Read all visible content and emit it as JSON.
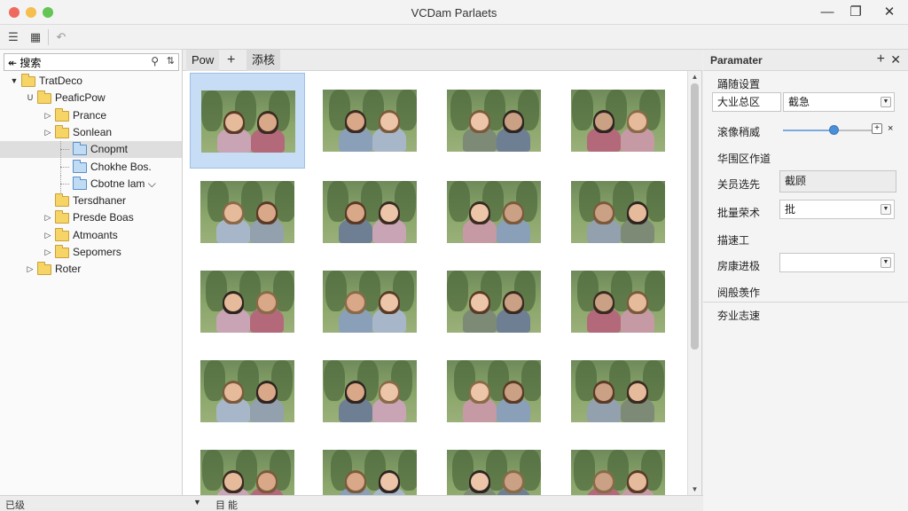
{
  "window": {
    "title": "VCDam Parlaets"
  },
  "toolbar": {
    "icons": [
      "list-icon",
      "grid-icon",
      "back-icon"
    ]
  },
  "search": {
    "value": "搜索",
    "prefix": "↞"
  },
  "tree": {
    "items": [
      {
        "label": "TratDeco",
        "level": 0,
        "expander": "▼",
        "folder": "yellow"
      },
      {
        "label": "PeaficPow",
        "level": 1,
        "expander": "U",
        "folder": "yellow"
      },
      {
        "label": "Prance",
        "level": 2,
        "expander": "▷",
        "folder": "yellow"
      },
      {
        "label": "Sonlean",
        "level": 2,
        "expander": "▷",
        "folder": "yellow"
      },
      {
        "label": "Cnopmt",
        "level": 3,
        "expander": "",
        "folder": "blue",
        "selected": true
      },
      {
        "label": "Chokhe Bos.",
        "level": 3,
        "expander": "",
        "folder": "blue"
      },
      {
        "label": "Cbotne lam",
        "level": 3,
        "expander": "",
        "folder": "blue",
        "suffix": "⌵"
      },
      {
        "label": "Tersdhaner",
        "level": 2,
        "expander": "",
        "folder": "yellow"
      },
      {
        "label": "Presde Boas",
        "level": 2,
        "expander": "▷",
        "folder": "yellow"
      },
      {
        "label": "Atmoants",
        "level": 2,
        "expander": "▷",
        "folder": "yellow"
      },
      {
        "label": "Sepomers",
        "level": 2,
        "expander": "▷",
        "folder": "yellow"
      },
      {
        "label": "Roter",
        "level": 1,
        "expander": "▷",
        "folder": "yellow"
      }
    ]
  },
  "tabs": {
    "items": [
      "Pow",
      "添核"
    ],
    "add": "+"
  },
  "grid": {
    "rows": 5,
    "cols": 4,
    "selected_index": 0
  },
  "params": {
    "title": "Paramater",
    "add": "+",
    "close": "✕",
    "section1": "踊随设置",
    "row1_label": "大业总区",
    "row1_value": "截急",
    "row2_label": "滚像稍威",
    "row2_slider": 0.75,
    "row2_end": "×",
    "row3_label": "华围区作道",
    "row4_label": "关员选先",
    "row4_value": "截顾",
    "row5_label": "批量荣术",
    "row5_value": "批",
    "row6_label": "描速工",
    "row7_label": "房康进极",
    "row7_value": "",
    "row8_label": "阅般羡作",
    "row9_label": "夯业志速"
  },
  "status": {
    "left": "已级",
    "view": "目 能",
    "dropdown": "▼"
  }
}
